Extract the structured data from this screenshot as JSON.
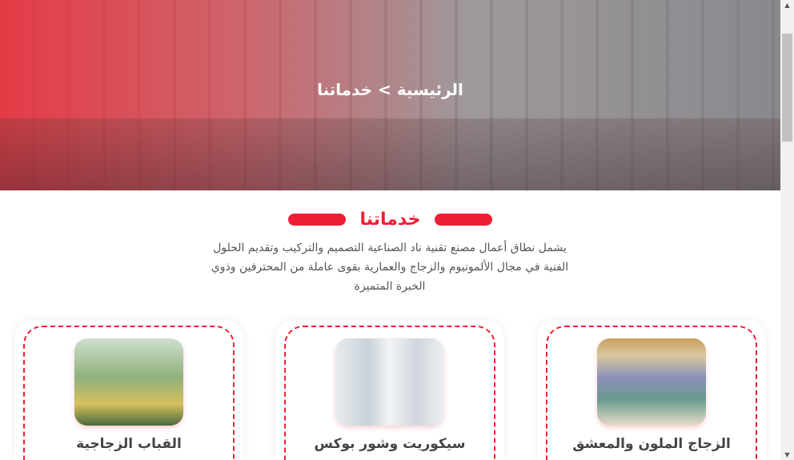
{
  "hero": {
    "breadcrumb": "الرئيسية > خدماتنا"
  },
  "section": {
    "title": "خدماتنا",
    "description": "يشمل نطاق أعمال مصنع تقنية ناد الصناعية التصميم والتركيب وتقديم الحلول الفنية في مجال الألمونيوم والزجاج والعمارية بقوى عاملة من المحترفين وذوي الخبرة المتميزة"
  },
  "cards": [
    {
      "title": "القباب الزجاجية",
      "image": "glass-dome"
    },
    {
      "title": "سيكوريت وشور بوكس",
      "image": "shower-box"
    },
    {
      "title": "الزجاج الملون والمعشق",
      "image": "stained-glass"
    }
  ],
  "colors": {
    "accent": "#ee1f34"
  }
}
